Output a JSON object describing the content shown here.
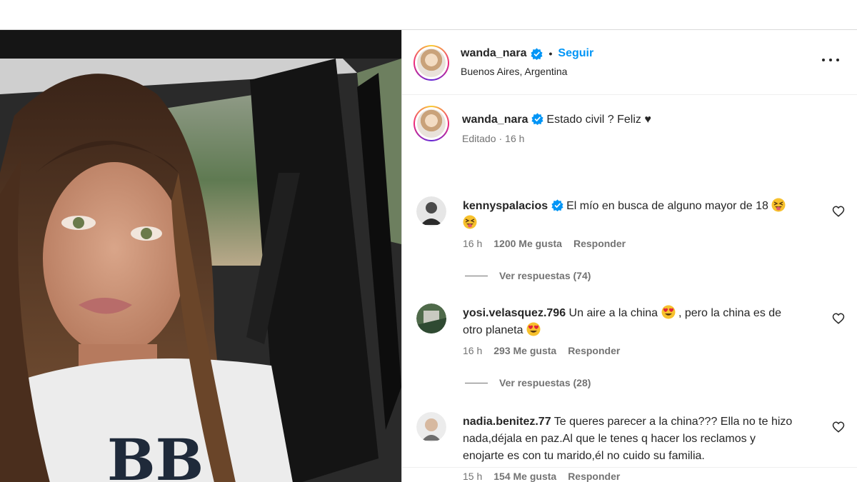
{
  "post": {
    "username": "wanda_nara",
    "follow_label": "Seguir",
    "location": "Buenos Aires, Argentina",
    "caption": "Estado civil ? Feliz ♥",
    "edited_label": "Editado",
    "time": "16 h"
  },
  "comments": [
    {
      "username": "kennyspalacios",
      "verified": true,
      "text": "El mío en busca de alguno mayor de 18",
      "time": "16 h",
      "likes": "1200 Me gusta",
      "reply_label": "Responder",
      "view_replies": "Ver respuestas (74)"
    },
    {
      "username": "yosi.velasquez.796",
      "verified": false,
      "text_a": "Un aire a la china",
      "text_b": ", pero la china es de",
      "text_c": "otro planeta",
      "time": "16 h",
      "likes": "293 Me gusta",
      "reply_label": "Responder",
      "view_replies": "Ver respuestas (28)"
    },
    {
      "username": "nadia.benitez.77",
      "verified": false,
      "text_line1": "Te queres parecer a la china??? Ella no te hizo",
      "text_line2": "nada,déjala en paz.Al que le tenes q hacer los reclamos y",
      "text_line3": "enojarte es con tu marido,él no cuido su familia.",
      "time": "15 h",
      "likes": "154 Me gusta",
      "reply_label": "Responder"
    }
  ],
  "colors": {
    "accent": "#0095f6",
    "secondary_text": "#737373",
    "verified": "#0095f6"
  },
  "icons": [
    "verified-badge-icon",
    "more-options-icon",
    "heart-icon",
    "squinting-tongue-emoji",
    "heart-eyes-emoji"
  ]
}
